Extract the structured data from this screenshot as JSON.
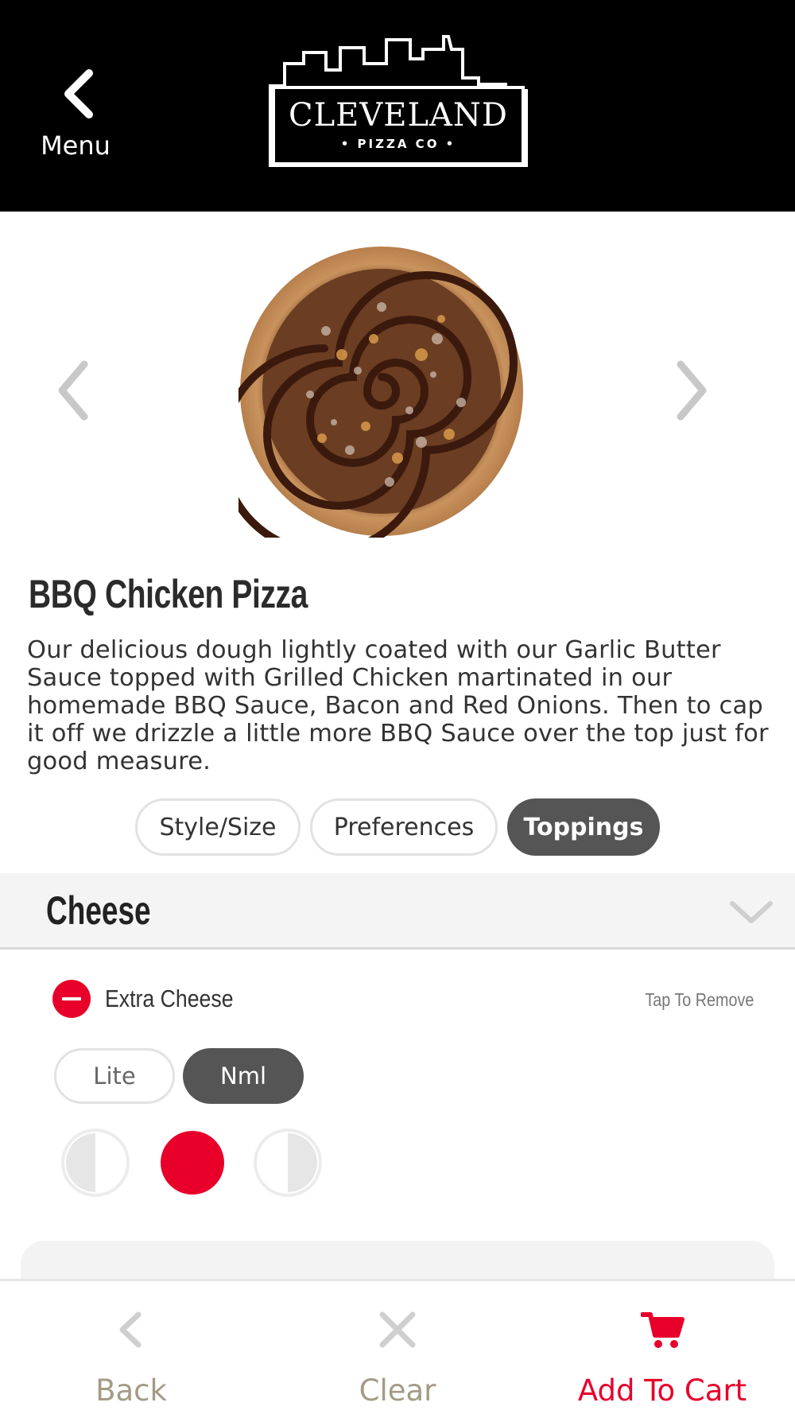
{
  "header": {
    "back_label": "Menu",
    "logo_text": "CLEVELAND",
    "logo_subtext": "• PIZZA CO •"
  },
  "product": {
    "name": "BBQ Chicken Pizza",
    "description": "Our delicious dough lightly coated with our Garlic Butter Sauce topped with Grilled Chicken martinated in our homemade BBQ Sauce, Bacon and Red Onions. Then to cap it off we drizzle a little more BBQ Sauce over the top just for good measure."
  },
  "tabs": [
    {
      "label": "Style/Size",
      "active": false
    },
    {
      "label": "Preferences",
      "active": false
    },
    {
      "label": "Toppings",
      "active": true
    }
  ],
  "toppings_section": {
    "title": "Cheese",
    "item": {
      "name": "Extra Cheese",
      "remove_hint": "Tap To Remove",
      "amount_options": [
        "Lite",
        "Nml"
      ],
      "selected_amount": "Nml",
      "coverage_options": [
        "left-half",
        "whole",
        "right-half"
      ],
      "selected_coverage": "whole"
    }
  },
  "bottom_bar": {
    "back_label": "Back",
    "clear_label": "Clear",
    "cart_label": "Add To Cart"
  },
  "colors": {
    "accent_red": "#e8002a",
    "active_pill": "#555555",
    "muted_label": "#a39b86",
    "header_bg": "#000000"
  },
  "icons": [
    "chevron-left-icon",
    "chevron-right-icon",
    "chevron-down-icon",
    "minus-circle-icon",
    "close-icon",
    "cart-icon"
  ]
}
